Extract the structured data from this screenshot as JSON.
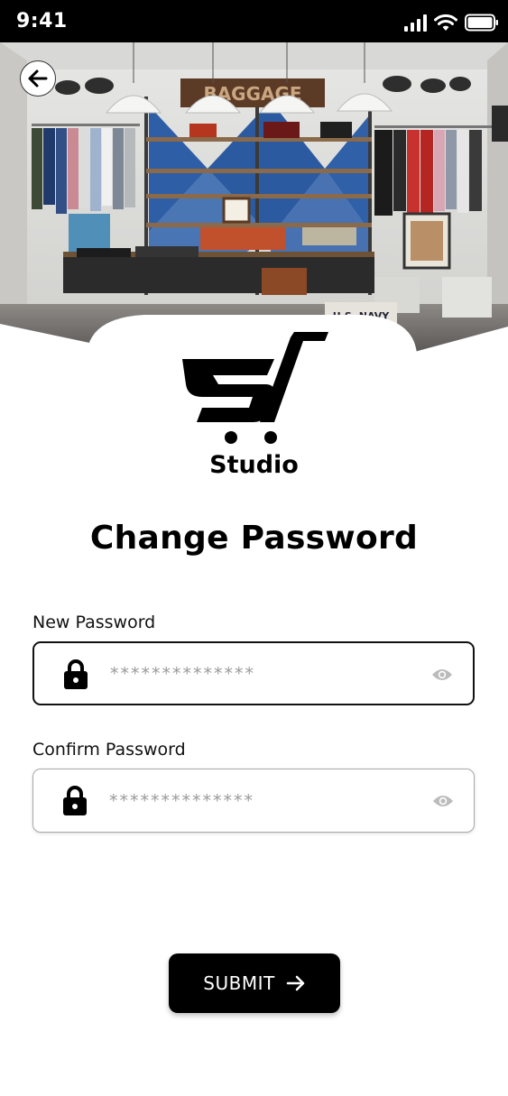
{
  "status_bar": {
    "time": "9:41"
  },
  "brand": {
    "name": "Studio"
  },
  "page": {
    "title": "Change Password"
  },
  "form": {
    "new_password": {
      "label": "New Password",
      "placeholder": "**************"
    },
    "confirm_password": {
      "label": "Confirm Password",
      "placeholder": "**************"
    },
    "submit_label": "SUBMIT"
  },
  "hero": {
    "store_sign": "BAGGAGE",
    "box_label": "U.S. NAVY"
  },
  "icons": {
    "back": "arrow-left-icon",
    "lock": "lock-icon",
    "eye": "eye-icon",
    "submit_arrow": "arrow-right-icon"
  },
  "colors": {
    "primary": "#000000",
    "background": "#ffffff",
    "placeholder": "#999999"
  }
}
